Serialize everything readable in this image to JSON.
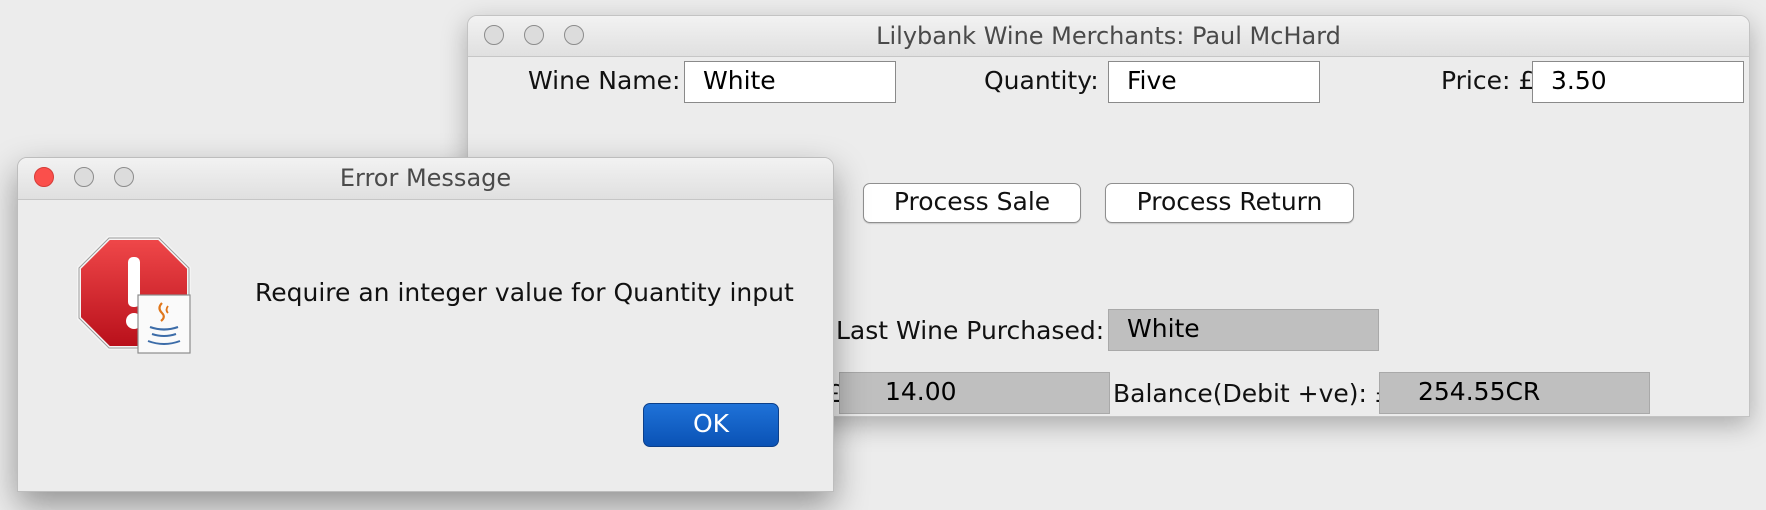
{
  "main_window": {
    "title": "Lilybank Wine Merchants: Paul McHard",
    "wine_name": {
      "label": "Wine Name:",
      "value": "White"
    },
    "quantity": {
      "label": "Quantity:",
      "value": "Five"
    },
    "price": {
      "label": "Price: £",
      "value": "3.50"
    },
    "buttons": {
      "process_sale": "Process Sale",
      "process_return": "Process Return"
    },
    "last_wine": {
      "label": "Last Wine Purchased:",
      "value": "White"
    },
    "amount": {
      "label_fragment": "£",
      "value": "14.00"
    },
    "balance": {
      "label": "Balance(Debit +ve): £",
      "value": "254.55CR"
    }
  },
  "dialog": {
    "title": "Error Message",
    "message": "Require an integer value for Quantity input",
    "ok_label": "OK",
    "icon": "error-stop-icon",
    "badge_icon": "java-coffee-icon"
  },
  "colors": {
    "ok_button": "#0a52b5",
    "close_light": "#fb4f4b",
    "error_icon": "#d0202a"
  }
}
